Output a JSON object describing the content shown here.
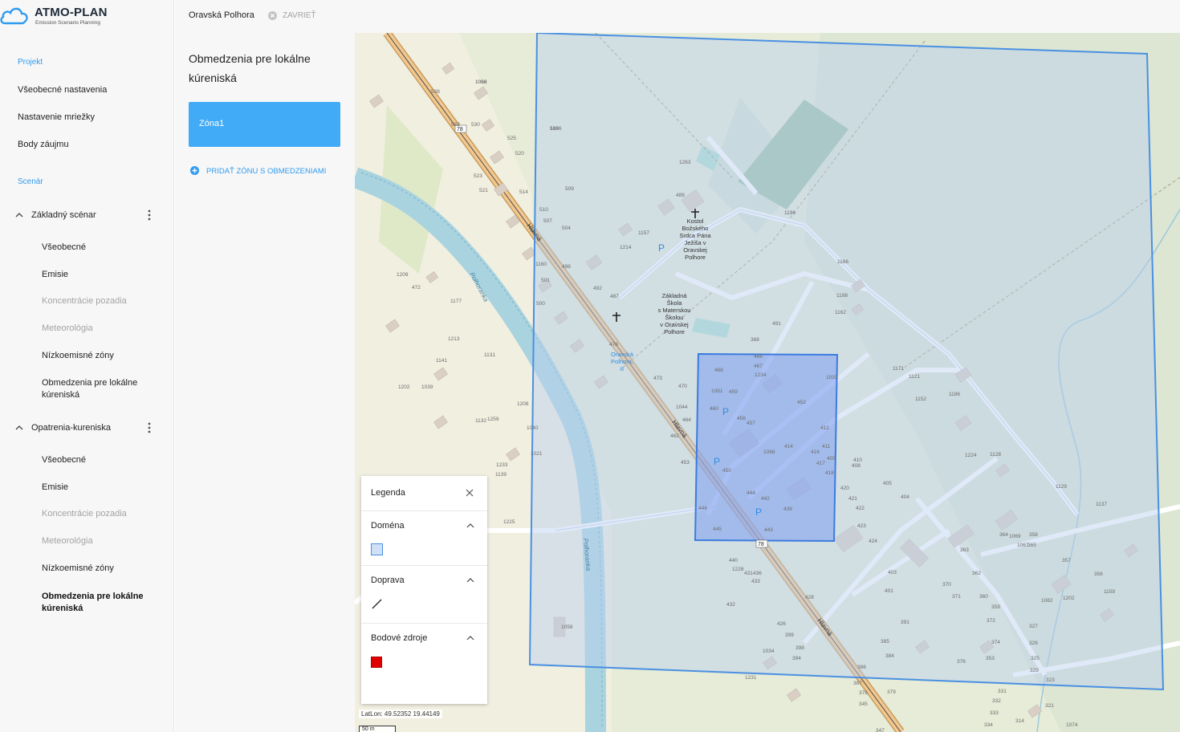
{
  "app": {
    "name": "ATMO-PLAN",
    "tagline": "Emission Scenario Planning"
  },
  "sidebar": {
    "project_label": "Projekt",
    "project_items": [
      "Všeobecné nastavenia",
      "Nastavenie mriežky",
      "Body záujmu"
    ],
    "scenario_label": "Scenár",
    "scenarios": [
      {
        "title": "Základný scénar",
        "items": [
          {
            "label": "Všeobecné",
            "state": "enabled"
          },
          {
            "label": "Emisie",
            "state": "enabled"
          },
          {
            "label": "Koncentrácie pozadia",
            "state": "disabled"
          },
          {
            "label": "Meteorológia",
            "state": "disabled"
          },
          {
            "label": "Nízkoemisné zóny",
            "state": "enabled"
          },
          {
            "label": "Obmedzenia pre lokálne kúreniská",
            "state": "enabled"
          }
        ]
      },
      {
        "title": "Opatrenia-kureniska",
        "items": [
          {
            "label": "Všeobecné",
            "state": "enabled"
          },
          {
            "label": "Emisie",
            "state": "enabled"
          },
          {
            "label": "Koncentrácie pozadia",
            "state": "disabled"
          },
          {
            "label": "Meteorológia",
            "state": "disabled"
          },
          {
            "label": "Nízkoemisné zóny",
            "state": "enabled"
          },
          {
            "label": "Obmedzenia pre lokálne kúreniská",
            "state": "active"
          }
        ]
      }
    ]
  },
  "topbar": {
    "location": "Oravská Polhora",
    "close_label": "ZAVRIEŤ"
  },
  "panel": {
    "title": "Obmedzenia pre lokálne kúreniská",
    "zone_name": "Zóna1",
    "add_zone_label": "PRIDAŤ ZÓNU S OBMEDZENIAMI"
  },
  "legend": {
    "title": "Legenda",
    "sections": [
      "Doména",
      "Doprava",
      "Bodové zdroje"
    ]
  },
  "map": {
    "latlon": "LatLon: 49.52352 19.44149",
    "scale": "50 m",
    "road_ref": "78",
    "street_name": "Hlavná",
    "river_name": "Polhoranka",
    "church_label": [
      "Kostol",
      "Božského",
      "Srdca Pána",
      "Ježiša v",
      "Oravskej",
      "Polhore"
    ],
    "school_label": [
      "Základná",
      "Škola",
      "s Materskou",
      "Školou",
      "v Oravskej",
      "Polhore"
    ],
    "bus_stop_label": [
      "Oravská",
      "Polhora,",
      "II"
    ],
    "colors": {
      "domain_stroke": "#4a90e2",
      "domain_fill": "#b9cff0",
      "zone_fill": "#7d9ff0",
      "river": "#a9d3df",
      "road_main": "#f2c88f",
      "accent": "#2e9bf0",
      "source": "#e00000"
    },
    "house_numbers": [
      {
        "text": "519"
      },
      {
        "text": "1092"
      },
      {
        "text": "538"
      },
      {
        "text": "532"
      },
      {
        "text": "530"
      },
      {
        "text": "525"
      },
      {
        "text": "520"
      },
      {
        "text": "523"
      },
      {
        "text": "521"
      },
      {
        "text": "514"
      },
      {
        "text": "509"
      },
      {
        "text": "510"
      },
      {
        "text": "507"
      },
      {
        "text": "504"
      },
      {
        "text": "1160"
      },
      {
        "text": "501"
      },
      {
        "text": "500"
      },
      {
        "text": "498"
      },
      {
        "text": "492"
      },
      {
        "text": "487"
      },
      {
        "text": "478"
      },
      {
        "text": "473"
      },
      {
        "text": "470"
      },
      {
        "text": "1044"
      },
      {
        "text": "464"
      },
      {
        "text": "462"
      },
      {
        "text": "453"
      },
      {
        "text": "448"
      },
      {
        "text": "445"
      },
      {
        "text": "440"
      },
      {
        "text": "436"
      },
      {
        "text": "433"
      },
      {
        "text": "431"
      },
      {
        "text": "432"
      },
      {
        "text": "428"
      },
      {
        "text": "426"
      },
      {
        "text": "399"
      },
      {
        "text": "398"
      },
      {
        "text": "394"
      },
      {
        "text": "1034"
      },
      {
        "text": "1228"
      },
      {
        "text": "1231"
      },
      {
        "text": "468"
      },
      {
        "text": "1081"
      },
      {
        "text": "459"
      },
      {
        "text": "460"
      },
      {
        "text": "456"
      },
      {
        "text": "457"
      },
      {
        "text": "450"
      },
      {
        "text": "444"
      },
      {
        "text": "443"
      },
      {
        "text": "439"
      },
      {
        "text": "442"
      },
      {
        "text": "414"
      },
      {
        "text": "1068"
      },
      {
        "text": "416"
      },
      {
        "text": "417"
      },
      {
        "text": "418"
      },
      {
        "text": "412"
      },
      {
        "text": "411"
      },
      {
        "text": "409"
      },
      {
        "text": "410"
      },
      {
        "text": "408"
      },
      {
        "text": "420"
      },
      {
        "text": "421"
      },
      {
        "text": "422"
      },
      {
        "text": "423"
      },
      {
        "text": "424"
      },
      {
        "text": "403"
      },
      {
        "text": "401"
      },
      {
        "text": "405"
      },
      {
        "text": "404"
      },
      {
        "text": "385"
      },
      {
        "text": "384"
      },
      {
        "text": "391"
      },
      {
        "text": "386"
      },
      {
        "text": "387"
      },
      {
        "text": "378"
      },
      {
        "text": "379"
      },
      {
        "text": "345"
      },
      {
        "text": "347"
      },
      {
        "text": "364"
      },
      {
        "text": "363"
      },
      {
        "text": "370"
      },
      {
        "text": "371"
      },
      {
        "text": "362"
      },
      {
        "text": "360"
      },
      {
        "text": "359"
      },
      {
        "text": "372"
      },
      {
        "text": "374"
      },
      {
        "text": "376"
      },
      {
        "text": "353"
      },
      {
        "text": "327"
      },
      {
        "text": "326"
      },
      {
        "text": "325"
      },
      {
        "text": "329"
      },
      {
        "text": "323"
      },
      {
        "text": "321"
      },
      {
        "text": "1074"
      },
      {
        "text": "331"
      },
      {
        "text": "332"
      },
      {
        "text": "333"
      },
      {
        "text": "334"
      },
      {
        "text": "314"
      },
      {
        "text": "358"
      },
      {
        "text": "357"
      },
      {
        "text": "356"
      },
      {
        "text": "1159"
      },
      {
        "text": "1082"
      },
      {
        "text": "1202"
      },
      {
        "text": "1069"
      },
      {
        "text": "1067"
      },
      {
        "text": "1137"
      },
      {
        "text": "365"
      },
      {
        "text": "1129"
      },
      {
        "text": "1128"
      },
      {
        "text": "1224"
      },
      {
        "text": "1186"
      },
      {
        "text": "1152"
      },
      {
        "text": "1121"
      },
      {
        "text": "1171"
      },
      {
        "text": "1162"
      },
      {
        "text": "1198"
      },
      {
        "text": "1166"
      },
      {
        "text": "1196"
      },
      {
        "text": "1263"
      },
      {
        "text": "489"
      },
      {
        "text": "1157"
      },
      {
        "text": "1214"
      },
      {
        "text": "491"
      },
      {
        "text": "368"
      },
      {
        "text": "466"
      },
      {
        "text": "467"
      },
      {
        "text": "1033"
      },
      {
        "text": "452"
      },
      {
        "text": "1234"
      },
      {
        "text": "1209"
      },
      {
        "text": "472"
      },
      {
        "text": "1177"
      },
      {
        "text": "1213"
      },
      {
        "text": "1131"
      },
      {
        "text": "1141"
      },
      {
        "text": "1039"
      },
      {
        "text": "1202"
      },
      {
        "text": "1208"
      },
      {
        "text": "1132"
      },
      {
        "text": "1259"
      },
      {
        "text": "1233"
      },
      {
        "text": "1139"
      },
      {
        "text": "1225"
      },
      {
        "text": "1058"
      },
      {
        "text": "1021"
      },
      {
        "text": "1040"
      },
      {
        "text": "1066"
      },
      {
        "text": "1086"
      }
    ]
  }
}
